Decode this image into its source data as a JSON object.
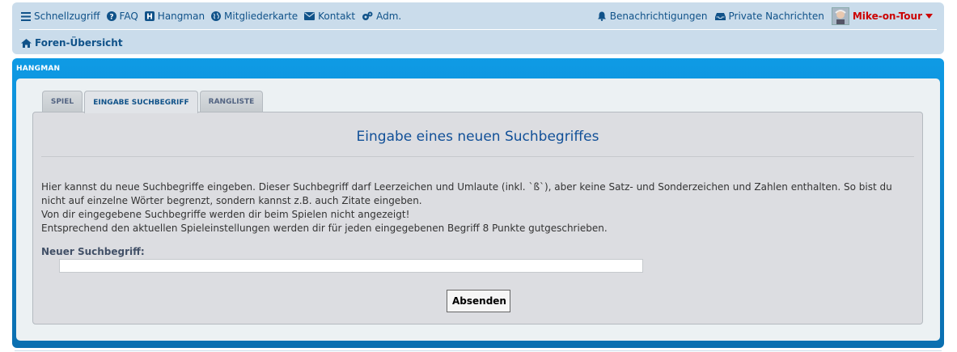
{
  "nav": {
    "left_items": [
      {
        "label": "Schnellzugriff",
        "icon": "bars-icon"
      },
      {
        "label": "FAQ",
        "icon": "question-circle-icon"
      },
      {
        "label": "Hangman",
        "icon": "h-square-icon"
      },
      {
        "label": "Mitgliederkarte",
        "icon": "globe-icon"
      },
      {
        "label": "Kontakt",
        "icon": "envelope-icon"
      },
      {
        "label": "Adm.",
        "icon": "cogs-icon"
      }
    ],
    "right_items": [
      {
        "label": "Benachrichtigungen",
        "icon": "bell-icon"
      },
      {
        "label": "Private Nachrichten",
        "icon": "inbox-icon"
      }
    ],
    "username": "Mike-on-Tour",
    "breadcrumb": "Foren-Übersicht",
    "accent_color": "#105289",
    "username_color": "#cc0000"
  },
  "panel": {
    "title": "HANGMAN",
    "tabs": [
      {
        "label": "SPIEL",
        "active": false
      },
      {
        "label": "EINGABE SUCHBEGRIFF",
        "active": true
      },
      {
        "label": "RANGLISTE",
        "active": false
      }
    ]
  },
  "form": {
    "heading": "Eingabe eines neuen Suchbegriffes",
    "intro_lines": [
      "Hier kannst du neue Suchbegriffe eingeben. Dieser Suchbegriff darf Leerzeichen und Umlaute (inkl. `ß`), aber keine Satz- und Sonderzeichen und Zahlen enthalten. So bist du nicht auf einzelne Wörter begrenzt, sondern kannst z.B. auch Zitate eingeben.",
      "Von dir eingegebene Suchbegriffe werden dir beim Spielen nicht angezeigt!",
      "Entsprechend den aktuellen Spieleinstellungen werden dir für jeden eingegebenen Begriff 8 Punkte gutgeschrieben."
    ],
    "field_label": "Neuer Suchbegriff:",
    "field_value": "",
    "submit_label": "Absenden"
  }
}
